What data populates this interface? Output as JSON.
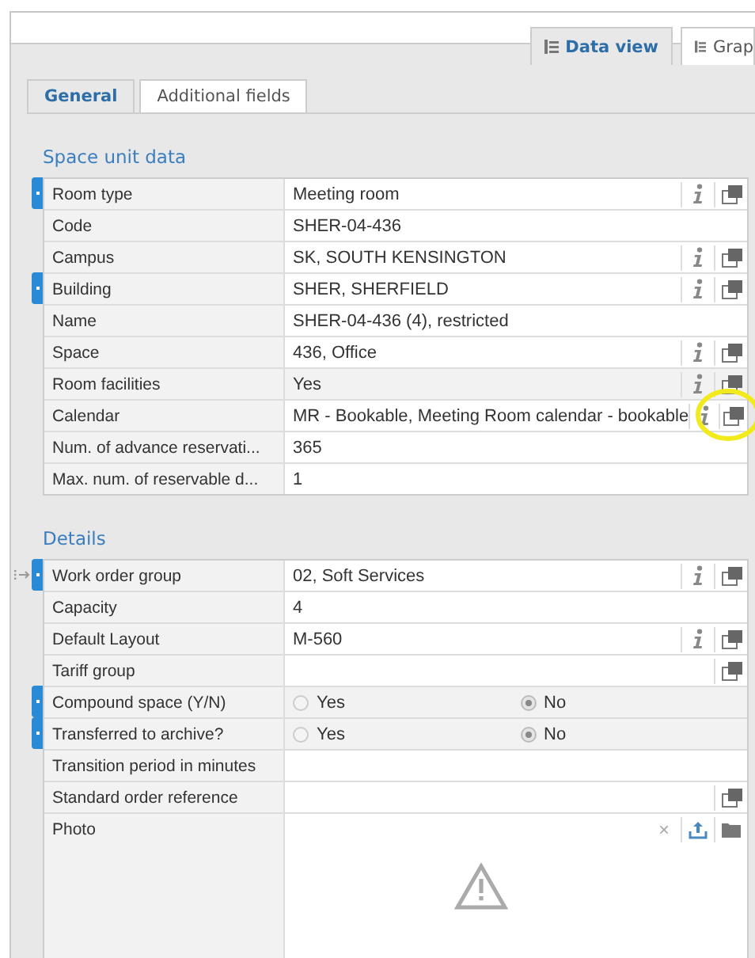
{
  "view_tabs": [
    {
      "label": "Data view",
      "selected": true
    },
    {
      "label": "Grap",
      "selected": false
    }
  ],
  "tabs": [
    {
      "label": "General",
      "selected": true
    },
    {
      "label": "Additional fields",
      "selected": false
    }
  ],
  "sections": [
    {
      "title": "Space unit data",
      "rows": [
        {
          "label": "Room type",
          "kind": "text",
          "value": "Meeting room",
          "required": true,
          "readonly": false,
          "info": true,
          "popup": true
        },
        {
          "label": "Code",
          "kind": "text",
          "value": "SHER-04-436",
          "required": false,
          "readonly": false,
          "info": false,
          "popup": false
        },
        {
          "label": "Campus",
          "kind": "text",
          "value": "SK, SOUTH KENSINGTON",
          "required": false,
          "readonly": false,
          "info": true,
          "popup": true
        },
        {
          "label": "Building",
          "kind": "text",
          "value": "SHER, SHERFIELD",
          "required": true,
          "readonly": false,
          "info": true,
          "popup": true
        },
        {
          "label": "Name",
          "kind": "text",
          "value": "SHER-04-436 (4), restricted",
          "required": false,
          "readonly": false,
          "info": false,
          "popup": false
        },
        {
          "label": "Space",
          "kind": "text",
          "value": "436, Office",
          "required": false,
          "readonly": false,
          "info": true,
          "popup": true
        },
        {
          "label": "Room facilities",
          "kind": "text",
          "value": "Yes",
          "required": false,
          "readonly": true,
          "info": true,
          "popup": true
        },
        {
          "label": "Calendar",
          "kind": "text",
          "value": "MR - Bookable, Meeting Room calendar - bookable",
          "required": false,
          "readonly": false,
          "info": true,
          "popup": true
        },
        {
          "label": "Num. of advance reservati...",
          "kind": "text",
          "value": "365",
          "required": false,
          "readonly": false,
          "info": false,
          "popup": false
        },
        {
          "label": "Max. num. of reservable d...",
          "kind": "text",
          "value": "1",
          "required": false,
          "readonly": false,
          "info": false,
          "popup": false
        }
      ]
    },
    {
      "title": "Details",
      "rows": [
        {
          "label": "Work order group",
          "kind": "text",
          "value": "02, Soft Services",
          "required": true,
          "draggable": true,
          "readonly": false,
          "info": true,
          "popup": true
        },
        {
          "label": "Capacity",
          "kind": "text",
          "value": "4",
          "required": false,
          "readonly": false,
          "info": false,
          "popup": false
        },
        {
          "label": "Default Layout",
          "kind": "text",
          "value": "M-560",
          "required": false,
          "readonly": false,
          "info": true,
          "popup": true
        },
        {
          "label": "Tariff group",
          "kind": "text",
          "value": "",
          "required": false,
          "readonly": false,
          "info": false,
          "popup": true
        },
        {
          "label": "Compound space (Y/N)",
          "kind": "radio",
          "required": true,
          "readonly": true,
          "options": [
            {
              "label": "Yes",
              "selected": false
            },
            {
              "label": "No",
              "selected": true
            }
          ]
        },
        {
          "label": "Transferred to archive?",
          "kind": "radio",
          "required": true,
          "readonly": true,
          "options": [
            {
              "label": "Yes",
              "selected": false
            },
            {
              "label": "No",
              "selected": true
            }
          ]
        },
        {
          "label": "Transition period in minutes",
          "kind": "text",
          "value": "",
          "required": false,
          "readonly": false,
          "info": false,
          "popup": false
        },
        {
          "label": "Standard order reference",
          "kind": "text",
          "value": "",
          "required": false,
          "readonly": false,
          "info": false,
          "popup": true
        },
        {
          "label": "Photo",
          "kind": "photo",
          "clear": "×",
          "required": false,
          "readonly": false
        }
      ]
    }
  ]
}
